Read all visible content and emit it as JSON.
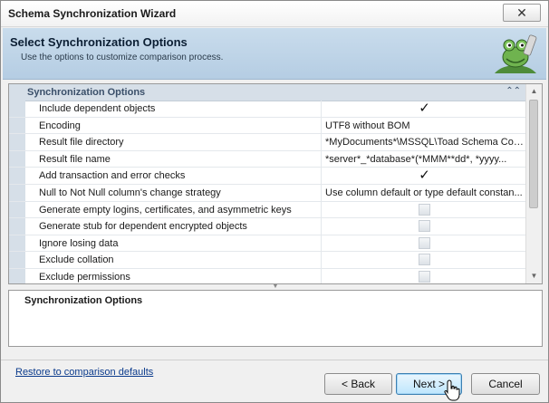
{
  "window": {
    "title": "Schema Synchronization Wizard",
    "close_label": "✕"
  },
  "header": {
    "title": "Select Synchronization Options",
    "subtitle": "Use the options to customize comparison process."
  },
  "grid": {
    "category": "Synchronization Options",
    "collapse_glyph": "⌃⌃",
    "rows": [
      {
        "name": "Include dependent objects",
        "type": "checkbox",
        "checked": true
      },
      {
        "name": "Encoding",
        "type": "text",
        "value": "UTF8 without BOM"
      },
      {
        "name": "Result file directory",
        "type": "text",
        "value": "*MyDocuments*\\MSSQL\\Toad Schema Com..."
      },
      {
        "name": "Result file name",
        "type": "text",
        "value": "*server*_*database*(*MMM**dd*, *yyyy..."
      },
      {
        "name": "Add transaction and error checks",
        "type": "checkbox",
        "checked": true
      },
      {
        "name": "Null to Not Null column's change strategy",
        "type": "text",
        "value": "Use column default or type default constan..."
      },
      {
        "name": "Generate empty logins, certificates, and asymmetric keys",
        "type": "checkbox",
        "checked": false
      },
      {
        "name": "Generate stub for dependent encrypted objects",
        "type": "checkbox",
        "checked": false
      },
      {
        "name": "Ignore losing data",
        "type": "checkbox",
        "checked": false
      },
      {
        "name": "Exclude collation",
        "type": "checkbox",
        "checked": false
      },
      {
        "name": "Exclude permissions",
        "type": "checkbox",
        "checked": false
      }
    ]
  },
  "description": {
    "title": "Synchronization Options"
  },
  "footer": {
    "restore_link": "Restore to comparison defaults",
    "back_label": "< Back",
    "next_label": "Next >",
    "cancel_label": "Cancel"
  }
}
